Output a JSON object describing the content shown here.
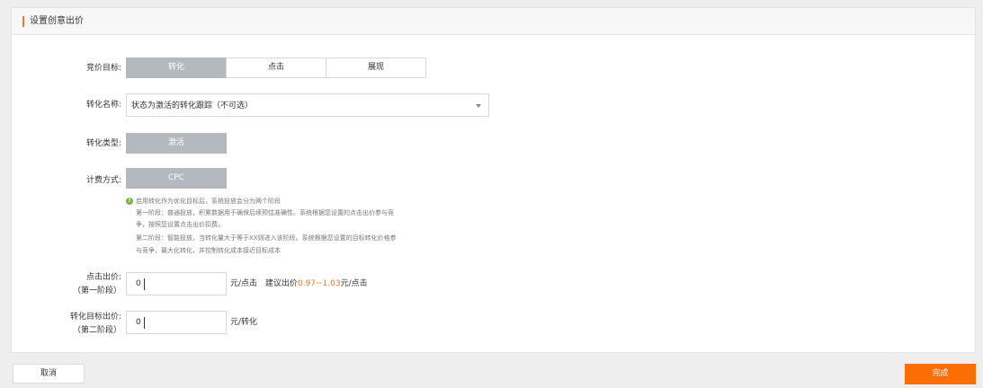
{
  "panel": {
    "title": "设置创意出价"
  },
  "bid_target": {
    "label": "竞价目标:",
    "options": [
      "转化",
      "点击",
      "展现"
    ],
    "selected": "转化"
  },
  "conversion_name": {
    "label": "转化名称:",
    "value": "状态为激活的转化跟踪（不可选）"
  },
  "conversion_type": {
    "label": "转化类型:",
    "value": "激活"
  },
  "billing_method": {
    "label": "计费方式:",
    "value": "CPC"
  },
  "tip": {
    "icon": "!",
    "lines": [
      "启用转化作为优化目标后，系统投放会分为两个阶段",
      "第一阶段：普通投放，积累数据用于确保后续预估准确性。系统根据您设置的点击出价参与竞",
      "争，按照您设置点击出价扣费。",
      "第二阶段：智能投放，当转化量大于等于XX则进入该阶段。系统根据您设置的目标转化价格参",
      "与竞争，最大化转化，并控制转化成本接近目标成本"
    ]
  },
  "click_bid": {
    "label_line1": "点击出价:",
    "label_line2": "（第一阶段）",
    "value": "0",
    "unit": "元/点击",
    "suggest_prefix": "建议出价",
    "suggest_range": "0.97~1.03",
    "suggest_suffix": "元/点击"
  },
  "target_bid": {
    "label_line1": "转化目标出价:",
    "label_line2": "（第二阶段）",
    "value": "0",
    "unit": "元/转化"
  },
  "footer": {
    "cancel": "取消",
    "done": "完成"
  },
  "colors": {
    "accent": "#f07a28",
    "primary_button": "#fb6d05",
    "active_segment": "#b3b9be"
  }
}
